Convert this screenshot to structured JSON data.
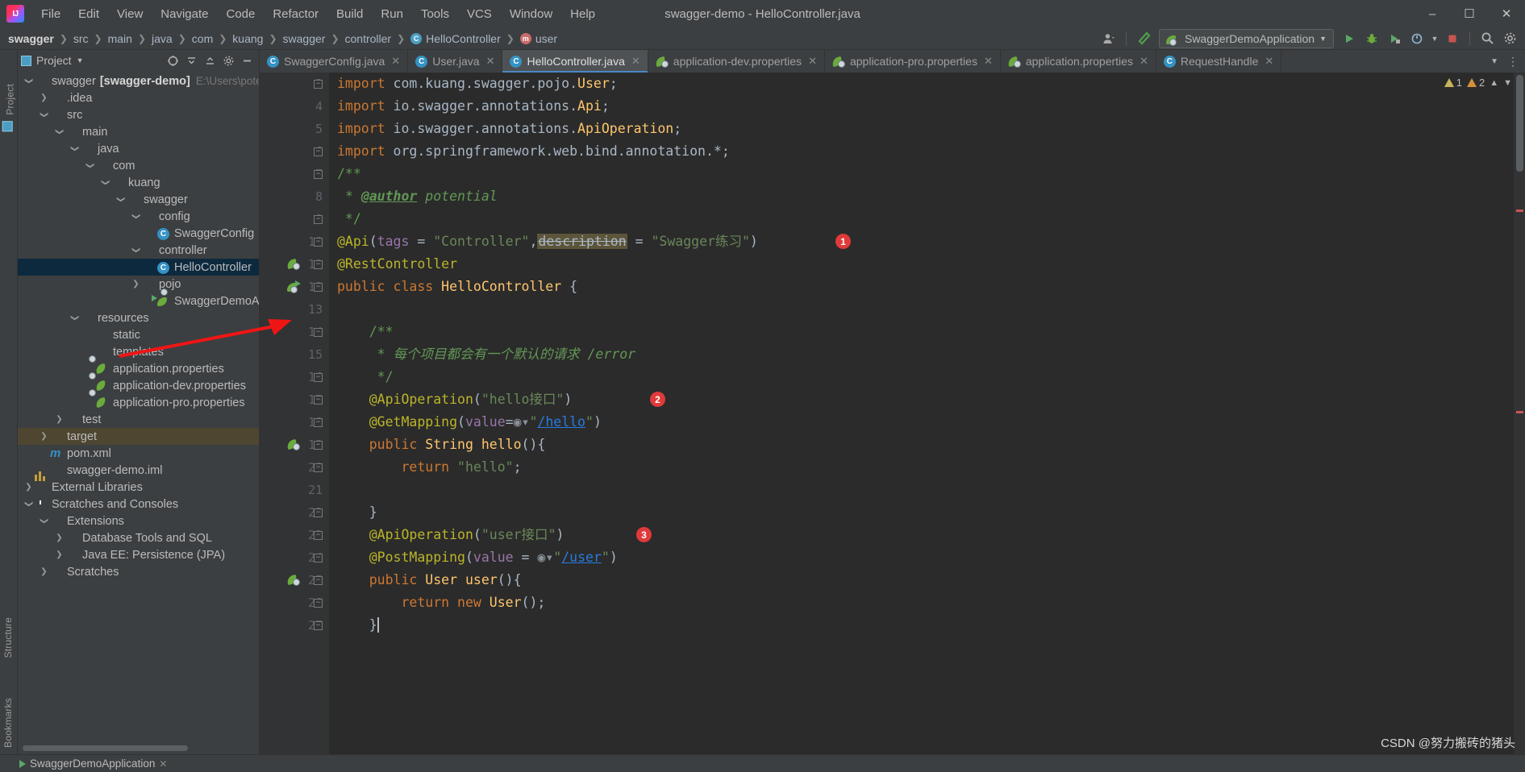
{
  "window": {
    "title": "swagger-demo - HelloController.java",
    "minimize": "–",
    "maximize": "☐",
    "close": "✕"
  },
  "menu": {
    "items": [
      {
        "label": "File",
        "mnemonic": "F"
      },
      {
        "label": "Edit",
        "mnemonic": "E"
      },
      {
        "label": "View",
        "mnemonic": "V"
      },
      {
        "label": "Navigate",
        "mnemonic": "N"
      },
      {
        "label": "Code",
        "mnemonic": "C"
      },
      {
        "label": "Refactor",
        "mnemonic": "R"
      },
      {
        "label": "Build",
        "mnemonic": "B"
      },
      {
        "label": "Run",
        "mnemonic": "u"
      },
      {
        "label": "Tools",
        "mnemonic": "T"
      },
      {
        "label": "VCS",
        "mnemonic": "S"
      },
      {
        "label": "Window",
        "mnemonic": "W"
      },
      {
        "label": "Help",
        "mnemonic": "H"
      }
    ]
  },
  "navbar": {
    "crumbs": [
      {
        "label": "swagger",
        "icon": "none",
        "bold": true
      },
      {
        "label": "src",
        "icon": "none",
        "bold": false
      },
      {
        "label": "main",
        "icon": "none",
        "bold": false
      },
      {
        "label": "java",
        "icon": "none",
        "bold": false
      },
      {
        "label": "com",
        "icon": "none",
        "bold": false
      },
      {
        "label": "kuang",
        "icon": "none",
        "bold": false
      },
      {
        "label": "swagger",
        "icon": "none",
        "bold": false
      },
      {
        "label": "controller",
        "icon": "none",
        "bold": false
      },
      {
        "label": "HelloController",
        "icon": "class",
        "bold": false
      },
      {
        "label": "user",
        "icon": "method",
        "bold": false
      }
    ],
    "separator": "❯",
    "run_config": "SwaggerDemoApplication",
    "icons": {
      "user": "user-icon",
      "hammer": "build-hammer-icon",
      "dropdown": "chevron-down-icon",
      "run": "run-icon",
      "debug": "debug-icon",
      "coverage": "coverage-icon",
      "profile": "profile-icon",
      "stop": "stop-icon",
      "search": "search-icon",
      "settings": "settings-icon"
    }
  },
  "project_panel": {
    "title": "Project",
    "header_icons": [
      "collapse-all-icon",
      "expand-all-icon",
      "sort-icon",
      "settings-icon",
      "hide-icon"
    ],
    "tree": [
      {
        "label": "swagger",
        "bold_part": "[swagger-demo]",
        "path": "E:\\Users\\potent",
        "indent": 0,
        "icon": "module-folder",
        "twist": "open",
        "state": "none"
      },
      {
        "label": ".idea",
        "indent": 1,
        "icon": "folder-grey",
        "twist": "closed",
        "state": "none"
      },
      {
        "label": "src",
        "indent": 1,
        "icon": "folder-grey",
        "twist": "open",
        "state": "none"
      },
      {
        "label": "main",
        "indent": 2,
        "icon": "folder-grey",
        "twist": "open",
        "state": "none"
      },
      {
        "label": "java",
        "indent": 3,
        "icon": "folder-blue",
        "twist": "open",
        "state": "none"
      },
      {
        "label": "com",
        "indent": 4,
        "icon": "package",
        "twist": "open",
        "state": "none"
      },
      {
        "label": "kuang",
        "indent": 5,
        "icon": "package",
        "twist": "open",
        "state": "none"
      },
      {
        "label": "swagger",
        "indent": 6,
        "icon": "package",
        "twist": "open",
        "state": "none"
      },
      {
        "label": "config",
        "indent": 7,
        "icon": "package",
        "twist": "open",
        "state": "none"
      },
      {
        "label": "SwaggerConfig",
        "indent": 8,
        "icon": "java-class",
        "twist": "none",
        "state": "none"
      },
      {
        "label": "controller",
        "indent": 7,
        "icon": "package",
        "twist": "open",
        "state": "none"
      },
      {
        "label": "HelloController",
        "indent": 8,
        "icon": "java-class",
        "twist": "none",
        "state": "selected"
      },
      {
        "label": "pojo",
        "indent": 7,
        "icon": "package",
        "twist": "closed",
        "state": "none"
      },
      {
        "label": "SwaggerDemoApplic",
        "indent": 8,
        "icon": "spring-run",
        "twist": "none",
        "state": "none"
      },
      {
        "label": "resources",
        "indent": 3,
        "icon": "folder-resources",
        "twist": "open",
        "state": "none"
      },
      {
        "label": "static",
        "indent": 4,
        "icon": "folder-grey",
        "twist": "none",
        "state": "none"
      },
      {
        "label": "templates",
        "indent": 4,
        "icon": "folder-grey",
        "twist": "none",
        "state": "none"
      },
      {
        "label": "application.properties",
        "indent": 4,
        "icon": "spring-file",
        "twist": "none",
        "state": "none"
      },
      {
        "label": "application-dev.properties",
        "indent": 4,
        "icon": "spring-file",
        "twist": "none",
        "state": "none"
      },
      {
        "label": "application-pro.properties",
        "indent": 4,
        "icon": "spring-file",
        "twist": "none",
        "state": "none"
      },
      {
        "label": "test",
        "indent": 2,
        "icon": "folder-grey",
        "twist": "closed",
        "state": "none"
      },
      {
        "label": "target",
        "indent": 1,
        "icon": "folder-orange",
        "twist": "closed",
        "state": "highlight"
      },
      {
        "label": "pom.xml",
        "indent": 1,
        "icon": "maven",
        "twist": "none",
        "state": "none"
      },
      {
        "label": "swagger-demo.iml",
        "indent": 1,
        "icon": "iml",
        "twist": "none",
        "state": "none"
      },
      {
        "label": "External Libraries",
        "indent": 0,
        "icon": "libraries",
        "twist": "closed",
        "state": "none"
      },
      {
        "label": "Scratches and Consoles",
        "indent": 0,
        "icon": "scratches",
        "twist": "open",
        "state": "none"
      },
      {
        "label": "Extensions",
        "indent": 1,
        "icon": "folder-grey",
        "twist": "open",
        "state": "none"
      },
      {
        "label": "Database Tools and SQL",
        "indent": 2,
        "icon": "folder-grey",
        "twist": "closed",
        "state": "none"
      },
      {
        "label": "Java EE: Persistence (JPA)",
        "indent": 2,
        "icon": "folder-grey",
        "twist": "closed",
        "state": "none"
      },
      {
        "label": "Scratches",
        "indent": 1,
        "icon": "folder-grey",
        "twist": "closed",
        "state": "none"
      }
    ]
  },
  "sidebar_labels": {
    "project": "Project",
    "structure": "Structure",
    "bookmarks": "Bookmarks"
  },
  "editor_tabs": [
    {
      "label": "SwaggerConfig.java",
      "icon": "java-class",
      "active": false,
      "close": "✕"
    },
    {
      "label": "User.java",
      "icon": "java-class",
      "active": false,
      "close": "✕"
    },
    {
      "label": "HelloController.java",
      "icon": "java-class",
      "active": true,
      "close": "✕"
    },
    {
      "label": "application-dev.properties",
      "icon": "spring-file",
      "active": false,
      "close": "✕"
    },
    {
      "label": "application-pro.properties",
      "icon": "spring-file",
      "active": false,
      "close": "✕"
    },
    {
      "label": "application.properties",
      "icon": "spring-file",
      "active": false,
      "close": "✕"
    },
    {
      "label": "RequestHandle",
      "icon": "java-class",
      "active": false,
      "close": "✕"
    }
  ],
  "editor": {
    "warnings": {
      "warn_count": "1",
      "error_count": "2"
    },
    "lines": [
      {
        "num": "3",
        "gutter": "none"
      },
      {
        "num": "4",
        "gutter": "none"
      },
      {
        "num": "5",
        "gutter": "none"
      },
      {
        "num": "6",
        "gutter": "none"
      },
      {
        "num": "7",
        "gutter": "none"
      },
      {
        "num": "8",
        "gutter": "none"
      },
      {
        "num": "9",
        "gutter": "none"
      },
      {
        "num": "10",
        "gutter": "none"
      },
      {
        "num": "11",
        "gutter": "spring-bean"
      },
      {
        "num": "12",
        "gutter": "spring-run"
      },
      {
        "num": "13",
        "gutter": "none"
      },
      {
        "num": "14",
        "gutter": "none"
      },
      {
        "num": "15",
        "gutter": "none"
      },
      {
        "num": "16",
        "gutter": "none"
      },
      {
        "num": "17",
        "gutter": "none"
      },
      {
        "num": "18",
        "gutter": "none"
      },
      {
        "num": "19",
        "gutter": "spring-bean"
      },
      {
        "num": "20",
        "gutter": "none"
      },
      {
        "num": "21",
        "gutter": "none"
      },
      {
        "num": "22",
        "gutter": "none"
      },
      {
        "num": "23",
        "gutter": "none"
      },
      {
        "num": "24",
        "gutter": "none"
      },
      {
        "num": "25",
        "gutter": "spring-bean"
      },
      {
        "num": "26",
        "gutter": "none"
      },
      {
        "num": "27",
        "gutter": "none"
      }
    ],
    "code_text": [
      "import com.kuang.swagger.pojo.User;",
      "import io.swagger.annotations.Api;",
      "import io.swagger.annotations.ApiOperation;",
      "import org.springframework.web.bind.annotation.*;",
      "/**",
      " * @author potential",
      " */",
      "@Api(tags = \"Controller\", description = \"Swagger练习\")",
      "@RestController",
      "public class HelloController {",
      "",
      "    /**",
      "     * 每个项目都会有一个默认的请求 /error",
      "     */",
      "    @ApiOperation(\"hello接口\")",
      "    @GetMapping(value=\"/hello\")",
      "    public String hello(){",
      "        return \"hello\";",
      "",
      "    }",
      "    @ApiOperation(\"user接口\")",
      "    @PostMapping(value = \"/user\")",
      "    public User user(){",
      "        return new User();",
      "    }"
    ],
    "markers": [
      {
        "number": "1",
        "line": 10
      },
      {
        "number": "2",
        "line": 17
      },
      {
        "number": "3",
        "line": 23
      }
    ]
  },
  "statusbar": {
    "run_label": "SwaggerDemoApplication",
    "run_icon": "run-icon",
    "close": "✕"
  },
  "watermark": "CSDN @努力搬砖的猪头",
  "colors": {
    "background": "#3c3f41",
    "editor_bg": "#2b2b2b",
    "accent": "#4a88c7",
    "selection": "#0d293e",
    "marker_red": "#e03a3a",
    "keyword_orange": "#cc7832",
    "string_green": "#6a8759",
    "class_yellow": "#ffc66d",
    "comment_green": "#629755",
    "annotation_yellow": "#bbb529",
    "highlight_target": "#4e4630"
  }
}
